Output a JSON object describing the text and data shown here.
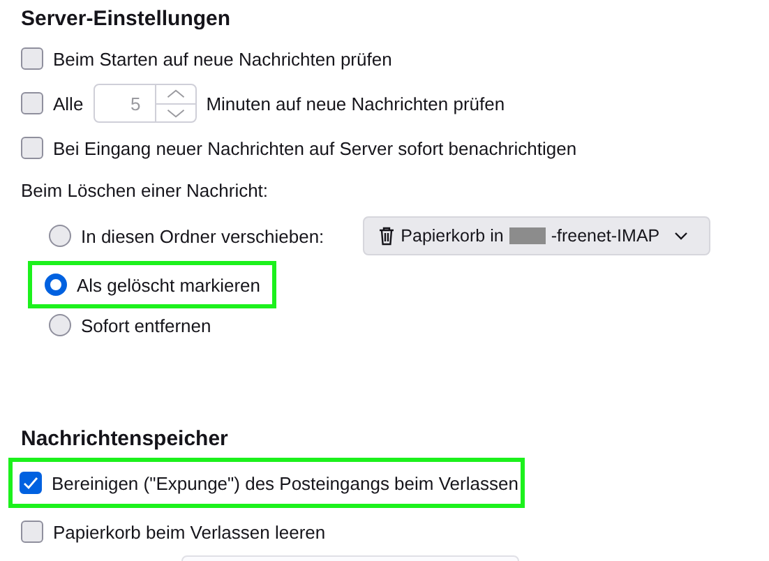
{
  "server_settings": {
    "title": "Server-Einstellungen",
    "options": [
      {
        "kind": "checkbox",
        "label": "Beim Starten auf neue Nachrichten prüfen",
        "checked": false
      },
      {
        "kind": "interval",
        "label": "Alle",
        "checked": false,
        "value": "5",
        "disabled": true,
        "suffix": "Minuten auf neue Nachrichten prüfen"
      },
      {
        "kind": "checkbox",
        "label": "Bei Eingang neuer Nachrichten auf Server sofort benachrichtigen",
        "checked": false
      }
    ],
    "delete_label": "Beim Löschen einer Nachricht:",
    "delete_options": [
      {
        "label": "In diesen Ordner verschieben:",
        "selected": false,
        "highlighted": false,
        "folder": {
          "text_before": "Papierkorb in",
          "redacted": true,
          "text_after": "-freenet-IMAP"
        }
      },
      {
        "label": "Als gelöscht markieren",
        "selected": true,
        "highlighted": true
      },
      {
        "label": "Sofort entfernen",
        "selected": false,
        "highlighted": false
      }
    ]
  },
  "message_storage": {
    "title": "Nachrichtenspeicher",
    "options": [
      {
        "label": "Bereinigen (\"Expunge\") des Posteingangs beim Verlassen",
        "checked": true,
        "highlighted": true
      },
      {
        "label": "Papierkorb beim Verlassen leeren",
        "checked": false,
        "highlighted": false
      }
    ]
  }
}
